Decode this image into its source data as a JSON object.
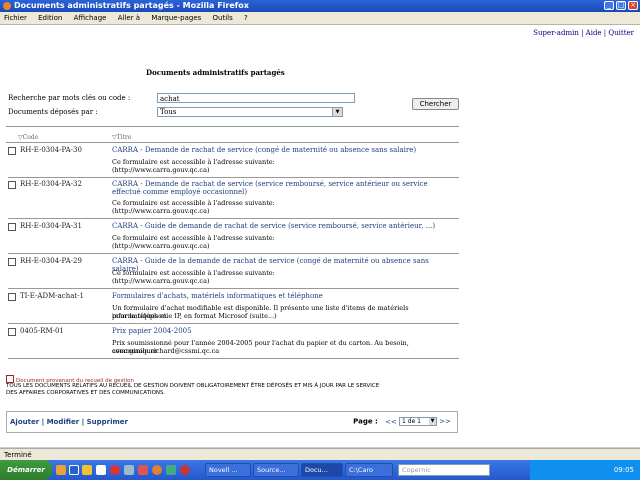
{
  "window": {
    "title": "Documents administratifs partagés - Mozilla Firefox"
  },
  "menu": [
    "Fichier",
    "Edition",
    "Affichage",
    "Aller à",
    "Marque-pages",
    "Outils",
    "?"
  ],
  "toplinks": {
    "super_admin": "Super-admin",
    "sep1": " | ",
    "aide": "Aide",
    "sep2": " | ",
    "quitter": "Quitter"
  },
  "page_title": "Documents administratifs partagés",
  "search": {
    "keyword_label": "Recherche par mots clés ou code :",
    "keyword_value": "achat",
    "deposited_label": "Documents déposés par :",
    "deposited_value": "Tous",
    "button": "Chercher"
  },
  "columns": {
    "code": "Code",
    "title": "Titre"
  },
  "rows": [
    {
      "code": "RH-E-0304-PA-30",
      "title": "CARRA - Demande de rachat de service (congé de maternité ou absence sans salaire)",
      "desc1": "Ce formulaire est accessible à l'adresse suivante:",
      "desc2": "(http://www.carra.gouv.qc.ca)"
    },
    {
      "code": "RH-E-0304-PA-32",
      "title": "CARRA - Demande de rachat de service (service remboursé, service antérieur ou service effectué comme employé occasionnel)",
      "desc1": "Ce formulaire est accessible à l'adresse suivante:",
      "desc2": "(http://www.carra.gouv.qc.ca)"
    },
    {
      "code": "RH-E-0304-PA-31",
      "title": "CARRA - Guide de demande de rachat de service (service remboursé, service antérieur, ...)",
      "desc1": "Ce formulaire est accessible à l'adresse suivante:",
      "desc2": "(http://www.carra.gouv.qc.ca)"
    },
    {
      "code": "RH-E-0304-PA-29",
      "title": "CARRA - Guide de la demande de rachat de service (congé de maternité ou absence sans salaire)",
      "desc1": "Ce formulaire est accessible à l'adresse suivante:",
      "desc2": "(http://www.carra.gouv.qc.ca)"
    },
    {
      "code": "TI-E-ADM-achat-1",
      "title": "Formulaires d'achats, matériels informatiques et téléphone",
      "desc1": "Un formulaire d'achat modifiable est disponible. Il présente une liste d'items de matériels informatiques et",
      "desc2": "pour la téléphonie IP, en format Microsof (suite...)"
    },
    {
      "code": "0405-RM-01",
      "title": "Prix papier 2004-2005",
      "desc1": "Prix soumissionné pour l'année 2004-2005 pour l'achat du papier et du carton. Au besoin, communiquer",
      "desc2": "avec gisele.richard@cssmi.qc.ca"
    }
  ],
  "legend": "Document provenant du recueil de gestion",
  "notice_line1": "TOUS LES DOCUMENTS RELATIFS AU RECUEIL DE GESTION DOIVENT OBLIGATOIREMENT ÊTRE DÉPOSÉS ET MIS À JOUR PAR LE SERVICE",
  "notice_line2": "DES AFFAIRES CORPORATIVES ET DES COMMUNICATIONS.",
  "footer": {
    "add": "Ajouter",
    "modify": "Modifier",
    "delete": "Supprimer",
    "sep": " | ",
    "page_label": "Page :",
    "prev": "<<",
    "page_select": "1 de 1",
    "next": ">>"
  },
  "status": "Terminé",
  "taskbar": {
    "start": "Démarrer",
    "tasks": [
      "Novell ...",
      "Source...",
      "Docu...",
      "C:\\Caro"
    ],
    "search_placeholder": "Copernic",
    "clock": "09:05"
  }
}
